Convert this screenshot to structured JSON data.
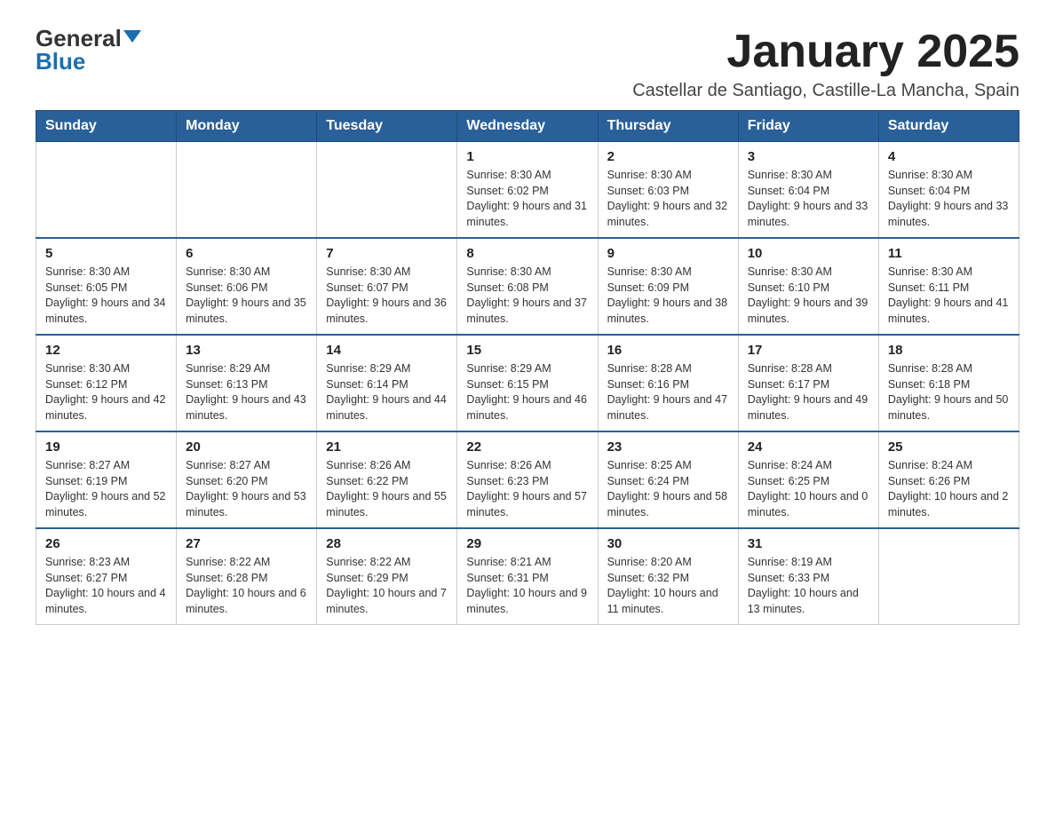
{
  "header": {
    "logo_general": "General",
    "logo_blue": "Blue",
    "month_title": "January 2025",
    "location": "Castellar de Santiago, Castille-La Mancha, Spain"
  },
  "weekdays": [
    "Sunday",
    "Monday",
    "Tuesday",
    "Wednesday",
    "Thursday",
    "Friday",
    "Saturday"
  ],
  "weeks": [
    [
      {
        "day": "",
        "info": ""
      },
      {
        "day": "",
        "info": ""
      },
      {
        "day": "",
        "info": ""
      },
      {
        "day": "1",
        "info": "Sunrise: 8:30 AM\nSunset: 6:02 PM\nDaylight: 9 hours and 31 minutes."
      },
      {
        "day": "2",
        "info": "Sunrise: 8:30 AM\nSunset: 6:03 PM\nDaylight: 9 hours and 32 minutes."
      },
      {
        "day": "3",
        "info": "Sunrise: 8:30 AM\nSunset: 6:04 PM\nDaylight: 9 hours and 33 minutes."
      },
      {
        "day": "4",
        "info": "Sunrise: 8:30 AM\nSunset: 6:04 PM\nDaylight: 9 hours and 33 minutes."
      }
    ],
    [
      {
        "day": "5",
        "info": "Sunrise: 8:30 AM\nSunset: 6:05 PM\nDaylight: 9 hours and 34 minutes."
      },
      {
        "day": "6",
        "info": "Sunrise: 8:30 AM\nSunset: 6:06 PM\nDaylight: 9 hours and 35 minutes."
      },
      {
        "day": "7",
        "info": "Sunrise: 8:30 AM\nSunset: 6:07 PM\nDaylight: 9 hours and 36 minutes."
      },
      {
        "day": "8",
        "info": "Sunrise: 8:30 AM\nSunset: 6:08 PM\nDaylight: 9 hours and 37 minutes."
      },
      {
        "day": "9",
        "info": "Sunrise: 8:30 AM\nSunset: 6:09 PM\nDaylight: 9 hours and 38 minutes."
      },
      {
        "day": "10",
        "info": "Sunrise: 8:30 AM\nSunset: 6:10 PM\nDaylight: 9 hours and 39 minutes."
      },
      {
        "day": "11",
        "info": "Sunrise: 8:30 AM\nSunset: 6:11 PM\nDaylight: 9 hours and 41 minutes."
      }
    ],
    [
      {
        "day": "12",
        "info": "Sunrise: 8:30 AM\nSunset: 6:12 PM\nDaylight: 9 hours and 42 minutes."
      },
      {
        "day": "13",
        "info": "Sunrise: 8:29 AM\nSunset: 6:13 PM\nDaylight: 9 hours and 43 minutes."
      },
      {
        "day": "14",
        "info": "Sunrise: 8:29 AM\nSunset: 6:14 PM\nDaylight: 9 hours and 44 minutes."
      },
      {
        "day": "15",
        "info": "Sunrise: 8:29 AM\nSunset: 6:15 PM\nDaylight: 9 hours and 46 minutes."
      },
      {
        "day": "16",
        "info": "Sunrise: 8:28 AM\nSunset: 6:16 PM\nDaylight: 9 hours and 47 minutes."
      },
      {
        "day": "17",
        "info": "Sunrise: 8:28 AM\nSunset: 6:17 PM\nDaylight: 9 hours and 49 minutes."
      },
      {
        "day": "18",
        "info": "Sunrise: 8:28 AM\nSunset: 6:18 PM\nDaylight: 9 hours and 50 minutes."
      }
    ],
    [
      {
        "day": "19",
        "info": "Sunrise: 8:27 AM\nSunset: 6:19 PM\nDaylight: 9 hours and 52 minutes."
      },
      {
        "day": "20",
        "info": "Sunrise: 8:27 AM\nSunset: 6:20 PM\nDaylight: 9 hours and 53 minutes."
      },
      {
        "day": "21",
        "info": "Sunrise: 8:26 AM\nSunset: 6:22 PM\nDaylight: 9 hours and 55 minutes."
      },
      {
        "day": "22",
        "info": "Sunrise: 8:26 AM\nSunset: 6:23 PM\nDaylight: 9 hours and 57 minutes."
      },
      {
        "day": "23",
        "info": "Sunrise: 8:25 AM\nSunset: 6:24 PM\nDaylight: 9 hours and 58 minutes."
      },
      {
        "day": "24",
        "info": "Sunrise: 8:24 AM\nSunset: 6:25 PM\nDaylight: 10 hours and 0 minutes."
      },
      {
        "day": "25",
        "info": "Sunrise: 8:24 AM\nSunset: 6:26 PM\nDaylight: 10 hours and 2 minutes."
      }
    ],
    [
      {
        "day": "26",
        "info": "Sunrise: 8:23 AM\nSunset: 6:27 PM\nDaylight: 10 hours and 4 minutes."
      },
      {
        "day": "27",
        "info": "Sunrise: 8:22 AM\nSunset: 6:28 PM\nDaylight: 10 hours and 6 minutes."
      },
      {
        "day": "28",
        "info": "Sunrise: 8:22 AM\nSunset: 6:29 PM\nDaylight: 10 hours and 7 minutes."
      },
      {
        "day": "29",
        "info": "Sunrise: 8:21 AM\nSunset: 6:31 PM\nDaylight: 10 hours and 9 minutes."
      },
      {
        "day": "30",
        "info": "Sunrise: 8:20 AM\nSunset: 6:32 PM\nDaylight: 10 hours and 11 minutes."
      },
      {
        "day": "31",
        "info": "Sunrise: 8:19 AM\nSunset: 6:33 PM\nDaylight: 10 hours and 13 minutes."
      },
      {
        "day": "",
        "info": ""
      }
    ]
  ]
}
